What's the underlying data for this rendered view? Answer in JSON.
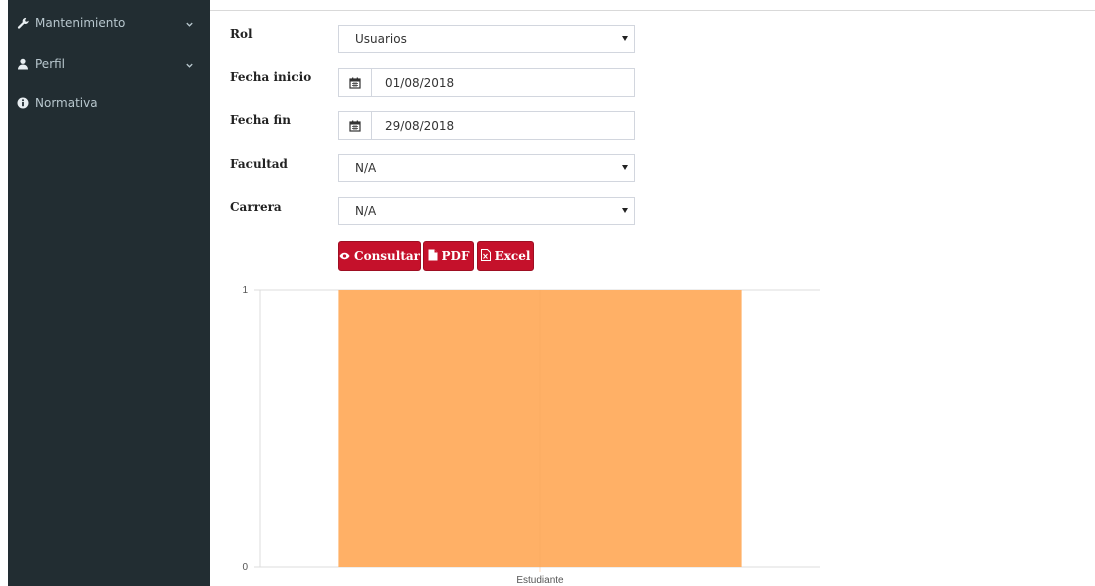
{
  "sidebar": {
    "items": [
      {
        "label": "Mantenimiento",
        "icon": "wrench-icon",
        "has_chevron": true
      },
      {
        "label": "Perfil",
        "icon": "user-icon",
        "has_chevron": true
      },
      {
        "label": "Normativa",
        "icon": "info-circle-icon",
        "has_chevron": false
      }
    ]
  },
  "form": {
    "rol": {
      "label": "Rol",
      "value": "Usuarios"
    },
    "fecha_inicio": {
      "label": "Fecha inicio",
      "value": "01/08/2018",
      "icon": "calendar-icon"
    },
    "fecha_fin": {
      "label": "Fecha fin",
      "value": "29/08/2018",
      "icon": "calendar-icon"
    },
    "facultad": {
      "label": "Facultad",
      "value": "N/A"
    },
    "carrera": {
      "label": "Carrera",
      "value": "N/A"
    }
  },
  "actions": {
    "consultar": {
      "label": "Consultar",
      "icon": "eye-icon"
    },
    "pdf": {
      "label": "PDF",
      "icon": "file-icon"
    },
    "excel": {
      "label": "Excel",
      "icon": "excel-file-icon"
    }
  },
  "colors": {
    "sidebar_bg": "#222d32",
    "button_red": "#c5112b",
    "bar_fill": "#ffb066"
  },
  "chart_data": {
    "type": "bar",
    "categories": [
      "Estudiante"
    ],
    "values": [
      1
    ],
    "ylim": [
      0,
      1
    ],
    "yticks": [
      "0",
      "1"
    ],
    "title": "",
    "xlabel": "",
    "ylabel": "",
    "grid": true,
    "bar_color": "#ffb066"
  }
}
